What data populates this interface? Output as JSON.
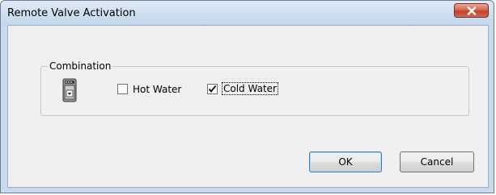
{
  "window": {
    "title": "Remote Valve Activation",
    "close_icon": "close-x-icon"
  },
  "group": {
    "label": "Combination",
    "icon": "valve-device-icon",
    "options": [
      {
        "label": "Hot Water",
        "checked": false
      },
      {
        "label": "Cold Water",
        "checked": true
      }
    ]
  },
  "buttons": {
    "ok_label": "OK",
    "cancel_label": "Cancel"
  },
  "colors": {
    "close_button": "#c2402a",
    "dialog_background": "#f0f0f0",
    "frame": "#c7daef"
  }
}
